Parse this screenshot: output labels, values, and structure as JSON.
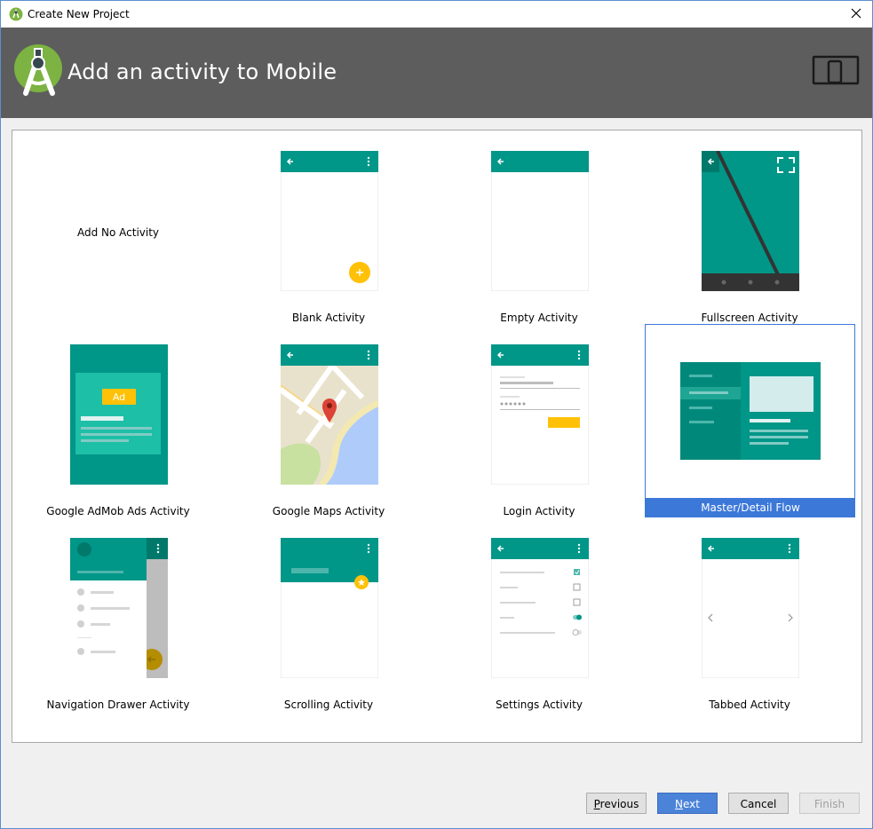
{
  "window": {
    "title": "Create New Project"
  },
  "header": {
    "title": "Add an activity to Mobile"
  },
  "colors": {
    "teal": "#009688",
    "header_bg": "#5d5d5d",
    "accent": "#ffc107",
    "selection": "#3c78d8"
  },
  "activities": [
    {
      "label": "Add No Activity"
    },
    {
      "label": "Blank Activity"
    },
    {
      "label": "Empty Activity"
    },
    {
      "label": "Fullscreen Activity"
    },
    {
      "label": "Google AdMob Ads Activity",
      "badge": "Ad"
    },
    {
      "label": "Google Maps Activity"
    },
    {
      "label": "Login Activity"
    },
    {
      "label": "Master/Detail Flow",
      "selected": true
    },
    {
      "label": "Navigation Drawer Activity"
    },
    {
      "label": "Scrolling Activity"
    },
    {
      "label": "Settings Activity"
    },
    {
      "label": "Tabbed Activity"
    }
  ],
  "buttons": {
    "previous": {
      "mnemonic": "P",
      "rest": "revious"
    },
    "next": {
      "mnemonic": "N",
      "rest": "ext"
    },
    "cancel": {
      "label": "Cancel"
    },
    "finish": {
      "label": "Finish"
    }
  }
}
